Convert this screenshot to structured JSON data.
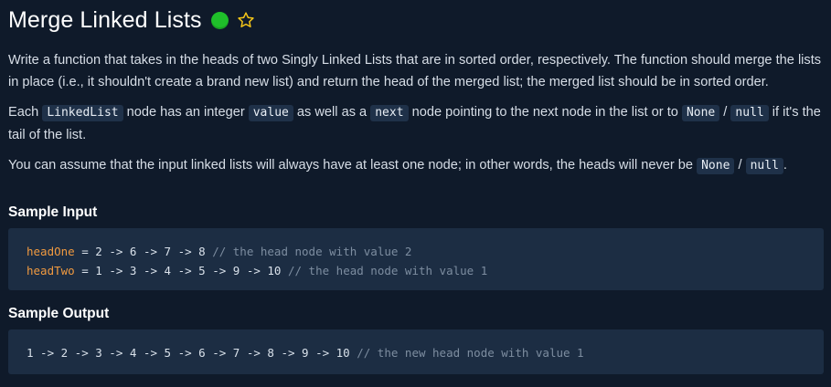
{
  "problem": {
    "title": "Merge Linked Lists",
    "difficulty_color": "#1fbf2a",
    "favorite_icon": "star-outline-icon"
  },
  "description": {
    "p1": "Write a function that takes in the heads of two Singly Linked Lists that are in sorted order, respectively. The function should merge the lists in place (i.e., it shouldn't create a brand new list) and return the head of the merged list; the merged list should be in sorted order.",
    "p2_a": "Each ",
    "p2_code1": "LinkedList",
    "p2_b": " node has an integer ",
    "p2_code2": "value",
    "p2_c": " as well as a ",
    "p2_code3": "next",
    "p2_d": " node pointing to the next node in the list or to ",
    "p2_code4": "None",
    "p2_e": " / ",
    "p2_code5": "null",
    "p2_f": " if it's the tail of the list.",
    "p3_a": "You can assume that the input linked lists will always have at least one node; in other words, the heads will never be ",
    "p3_code1": "None",
    "p3_b": " / ",
    "p3_code2": "null",
    "p3_c": "."
  },
  "sample_input": {
    "heading": "Sample Input",
    "line1_var": "headOne",
    "line1_rest": " = 2 -> 6 -> 7 -> 8 ",
    "line1_comment": "// the head node with value 2",
    "line2_var": "headTwo",
    "line2_rest": " = 1 -> 3 -> 4 -> 5 -> 9 -> 10 ",
    "line2_comment": "// the head node with value 1"
  },
  "sample_output": {
    "heading": "Sample Output",
    "line1_rest": "1 -> 2 -> 3 -> 4 -> 5 -> 6 -> 7 -> 8 -> 9 -> 10 ",
    "line1_comment": "// the new head node with value 1"
  }
}
